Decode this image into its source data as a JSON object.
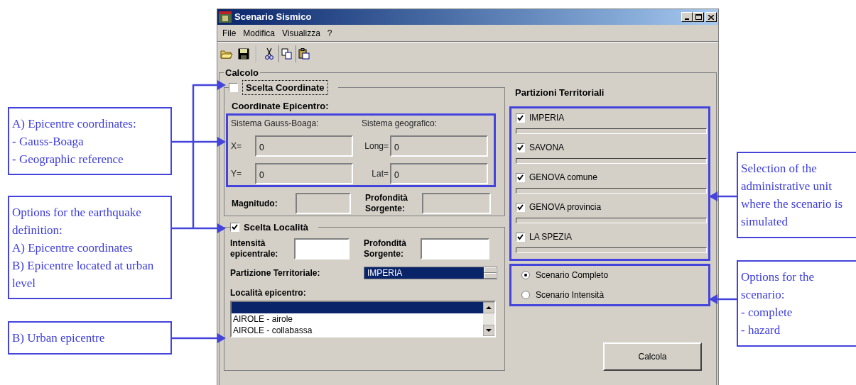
{
  "left_callouts": [
    {
      "text": "A)  Epicentre coordinates:\n- Gauss-Boaga\n- Geographic reference"
    },
    {
      "text": "Options for the earthquake definition:\nA) Epicentre coordinates\nB) Epicentre located at urban level"
    },
    {
      "text": "B) Urban epicentre"
    }
  ],
  "right_callouts": [
    {
      "text": "Selection of the administrative unit where the scenario is simulated"
    },
    {
      "text": "Options for the scenario:\n- complete\n- hazard"
    }
  ],
  "window": {
    "title": "Scenario Sismico"
  },
  "menu": [
    "File",
    "Modifica",
    "Visualizza",
    "?"
  ],
  "calcolo": {
    "label": "Calcolo",
    "coordinate_group": {
      "label": "Scelta Coordinate",
      "checked": false,
      "heading": "Coordinate Epicentro:",
      "gauss_label": "Sistema Gauss-Boaga:",
      "geo_label": "Sistema geografico:",
      "fields": [
        {
          "label": "X=",
          "value": "0"
        },
        {
          "label": "Long=",
          "value": "0"
        },
        {
          "label": "Y=",
          "value": "0"
        },
        {
          "label": "Lat=",
          "value": "0"
        }
      ],
      "magnitude_label": "Magnitudo:",
      "depth_label": "Profondità\nSorgente:"
    },
    "locality_group": {
      "label": "Scelta Località",
      "checked": true,
      "intensity_label": "Intensità\nepicentrale:",
      "depth_label": "Profondità\nSorgente:",
      "partition_label": "Partizione Territoriale:",
      "partition_value": "IMPERIA",
      "list_label": "Località epicentro:",
      "blank_row_selected": true,
      "items": [
        {
          "text": "AIROLE - airole",
          "selected": false
        },
        {
          "text": "AIROLE - collabassa",
          "selected": false
        }
      ]
    },
    "partitions": {
      "title": "Partizioni Territoriali",
      "items": [
        {
          "label": "IMPERIA",
          "checked": true,
          "level": 0
        },
        {
          "label": "SAVONA",
          "checked": true,
          "level": 0
        },
        {
          "label": "GENOVA comune",
          "checked": true,
          "level": 0
        },
        {
          "label": "GENOVA provincia",
          "checked": true,
          "level": 0
        },
        {
          "label": "LA SPEZIA",
          "checked": true,
          "level": 0
        }
      ]
    },
    "scenario_options": [
      {
        "label": "Scenario Completo",
        "selected": true
      },
      {
        "label": "Scenario Intensità",
        "selected": false
      }
    ],
    "button": "Calcola"
  }
}
